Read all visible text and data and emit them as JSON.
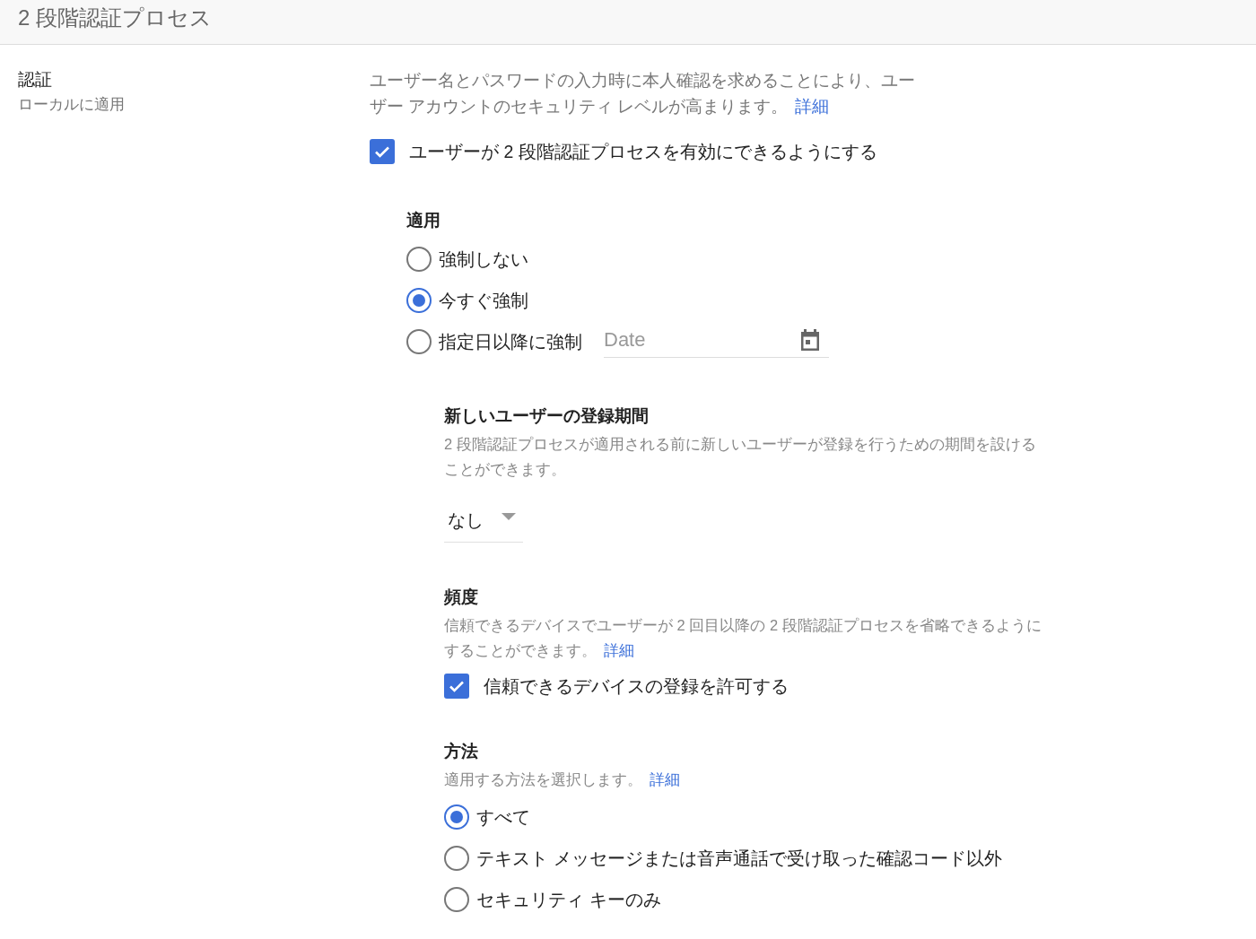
{
  "header": {
    "title": "2 段階認証プロセス"
  },
  "section": {
    "title": "認証",
    "subtitle": "ローカルに適用"
  },
  "description": {
    "text": "ユーザー名とパスワードの入力時に本人確認を求めることにより、ユーザー アカウントのセキュリティ レベルが高まります。",
    "link": "詳細"
  },
  "enable_checkbox": {
    "label": "ユーザーが 2 段階認証プロセスを有効にできるようにする",
    "checked": true
  },
  "enforcement": {
    "title": "適用",
    "options": [
      {
        "label": "強制しない",
        "selected": false
      },
      {
        "label": "今すぐ強制",
        "selected": true
      },
      {
        "label": "指定日以降に強制",
        "selected": false,
        "date_field": {
          "placeholder": "Date"
        }
      }
    ]
  },
  "new_user_enrollment": {
    "title": "新しいユーザーの登録期間",
    "description": "2 段階認証プロセスが適用される前に新しいユーザーが登録を行うための期間を設けることができます。",
    "dropdown": {
      "value": "なし"
    }
  },
  "frequency": {
    "title": "頻度",
    "description": "信頼できるデバイスでユーザーが 2 回目以降の 2 段階認証プロセスを省略できるようにすることができます。",
    "link": "詳細",
    "checkbox": {
      "label": "信頼できるデバイスの登録を許可する",
      "checked": true
    }
  },
  "methods": {
    "title": "方法",
    "description": "適用する方法を選択します。",
    "link": "詳細",
    "options": [
      {
        "label": "すべて",
        "selected": true
      },
      {
        "label": "テキスト メッセージまたは音声通話で受け取った確認コード以外",
        "selected": false
      },
      {
        "label": "セキュリティ キーのみ",
        "selected": false
      }
    ]
  }
}
